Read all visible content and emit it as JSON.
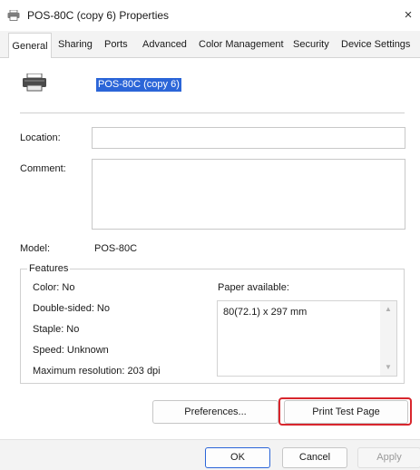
{
  "window": {
    "title": "POS-80C (copy 6) Properties",
    "close_glyph": "×",
    "icon": "printer-icon"
  },
  "tabs": [
    {
      "label": "General",
      "selected": true
    },
    {
      "label": "Sharing"
    },
    {
      "label": "Ports"
    },
    {
      "label": "Advanced"
    },
    {
      "label": "Color Management"
    },
    {
      "label": "Security"
    },
    {
      "label": "Device Settings"
    }
  ],
  "general": {
    "printer_name": "POS-80C (copy 6)",
    "location_label": "Location:",
    "location_value": "",
    "comment_label": "Comment:",
    "comment_value": "",
    "model_label": "Model:",
    "model_value": "POS-80C",
    "features": {
      "title": "Features",
      "color": "Color: No",
      "double_sided": "Double-sided: No",
      "staple": "Staple: No",
      "speed": "Speed: Unknown",
      "max_resolution": "Maximum resolution: 203 dpi",
      "paper_label": "Paper available:",
      "paper_items": [
        "80(72.1) x 297 mm"
      ]
    },
    "preferences_label": "Preferences...",
    "print_test_label": "Print Test Page"
  },
  "footer": {
    "ok": "OK",
    "cancel": "Cancel",
    "apply": "Apply"
  },
  "colors": {
    "highlight": "#d8262d",
    "selection": "#2b65d8"
  }
}
